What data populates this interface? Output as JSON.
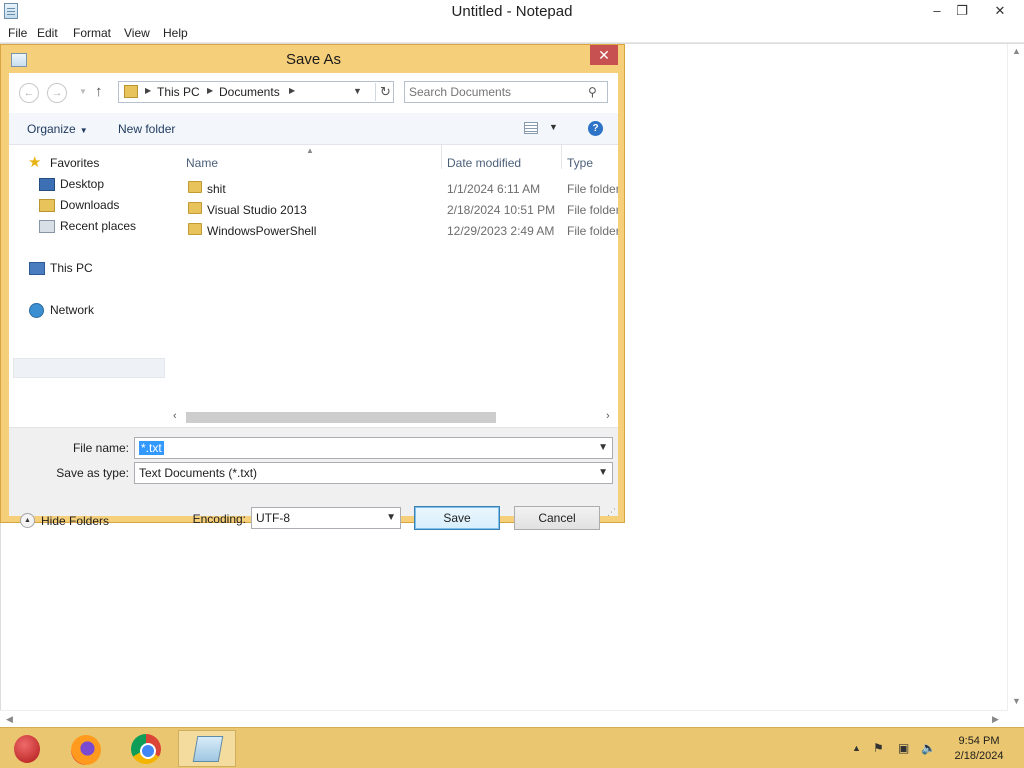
{
  "notepad": {
    "title": "Untitled - Notepad",
    "menu": [
      "File",
      "Edit",
      "Format",
      "View",
      "Help"
    ],
    "controls": {
      "minimize": "‒",
      "restore": "❐",
      "close": "✕"
    }
  },
  "dialog": {
    "title": "Save As",
    "close_glyph": "✕",
    "breadcrumb": [
      "This PC",
      "Documents"
    ],
    "search_placeholder": "Search Documents",
    "toolbar": {
      "organize": "Organize",
      "new_folder": "New folder",
      "help_glyph": "?"
    },
    "nav": {
      "favorites": "Favorites",
      "desktop": "Desktop",
      "downloads": "Downloads",
      "recent": "Recent places",
      "this_pc": "This PC",
      "network": "Network"
    },
    "columns": {
      "name": "Name",
      "date": "Date modified",
      "type": "Type"
    },
    "files": [
      {
        "name": "shit",
        "date": "1/1/2024 6:11 AM",
        "type": "File folder"
      },
      {
        "name": "Visual Studio 2013",
        "date": "2/18/2024 10:51 PM",
        "type": "File folder"
      },
      {
        "name": "WindowsPowerShell",
        "date": "12/29/2023 2:49 AM",
        "type": "File folder"
      }
    ],
    "file_name_label": "File name:",
    "file_name_value": "*.txt",
    "save_type_label": "Save as type:",
    "save_type_value": "Text Documents (*.txt)",
    "hide_folders": "Hide Folders",
    "encoding_label": "Encoding:",
    "encoding_value": "UTF-8",
    "save_button": "Save",
    "cancel_button": "Cancel"
  },
  "taskbar": {
    "apps": [
      "ornament-app-icon",
      "firefox-icon",
      "chrome-icon",
      "notepad-icon"
    ],
    "active_app": "notepad",
    "time": "9:54 PM",
    "date": "2/18/2024"
  },
  "colors": {
    "dialog_frame": "#f5cf7a",
    "taskbar": "#e9c66f",
    "close_red": "#c75050",
    "selection_blue": "#3399ff"
  }
}
